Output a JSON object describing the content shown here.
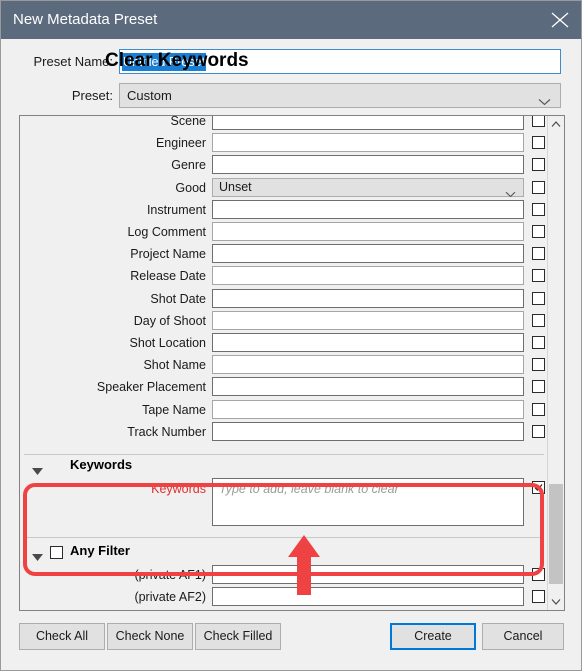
{
  "window": {
    "title": "New Metadata Preset",
    "close_icon": "close-icon",
    "titlebar_color": "#5b6a7d"
  },
  "preset_name_row": {
    "label": "Preset Name:",
    "selected_value": "Untitled Preset",
    "annotation_text": "Clear Keywords",
    "selection_color": "#1a7fd4"
  },
  "preset_row": {
    "label": "Preset:",
    "value": "Custom",
    "chevron_icon": "chevron-down-icon"
  },
  "fields": [
    {
      "label": "Scene",
      "type": "text",
      "value": "",
      "checked": false
    },
    {
      "label": "Engineer",
      "type": "text",
      "value": "",
      "checked": false
    },
    {
      "label": "Genre",
      "type": "text",
      "value": "",
      "checked": false
    },
    {
      "label": "Good",
      "type": "combo",
      "value": "Unset",
      "checked": false
    },
    {
      "label": "Instrument",
      "type": "text",
      "value": "",
      "checked": false
    },
    {
      "label": "Log Comment",
      "type": "text",
      "value": "",
      "checked": false
    },
    {
      "label": "Project Name",
      "type": "text",
      "value": "",
      "checked": false
    },
    {
      "label": "Release Date",
      "type": "text",
      "value": "",
      "checked": false
    },
    {
      "label": "Shot Date",
      "type": "text",
      "value": "",
      "checked": false
    },
    {
      "label": "Day of Shoot",
      "type": "text",
      "value": "",
      "checked": false
    },
    {
      "label": "Shot Location",
      "type": "text",
      "value": "",
      "checked": false
    },
    {
      "label": "Shot Name",
      "type": "text",
      "value": "",
      "checked": false
    },
    {
      "label": "Speaker Placement",
      "type": "text",
      "value": "",
      "checked": false
    },
    {
      "label": "Tape Name",
      "type": "text",
      "value": "",
      "checked": false
    },
    {
      "label": "Track Number",
      "type": "text",
      "value": "",
      "checked": false
    }
  ],
  "keywords_group": {
    "title": "Keywords",
    "expanded": true,
    "checked": true,
    "triangle_icon": "triangle-down-icon",
    "sub_label": "Keywords",
    "sub_label_color": "#e03030",
    "placeholder": "Type to add, leave blank to clear",
    "value": "",
    "row_checked": true
  },
  "any_filter_group": {
    "title": "Any Filter",
    "expanded": true,
    "checked": false,
    "triangle_icon": "triangle-down-icon",
    "fields": [
      {
        "label": "(private AF1)",
        "value": "",
        "checked": false
      },
      {
        "label": "(private AF2)",
        "value": "",
        "checked": false
      }
    ]
  },
  "scrollbar": {
    "up_icon": "chevron-up-icon",
    "down_icon": "chevron-down-icon"
  },
  "buttons": {
    "check_all": "Check All",
    "check_none": "Check None",
    "check_filled": "Check Filled",
    "create": "Create",
    "cancel": "Cancel",
    "focus_color": "#0078d7"
  },
  "annotation": {
    "color": "#ef4343",
    "shape": "rounded-rect-and-up-arrow"
  }
}
